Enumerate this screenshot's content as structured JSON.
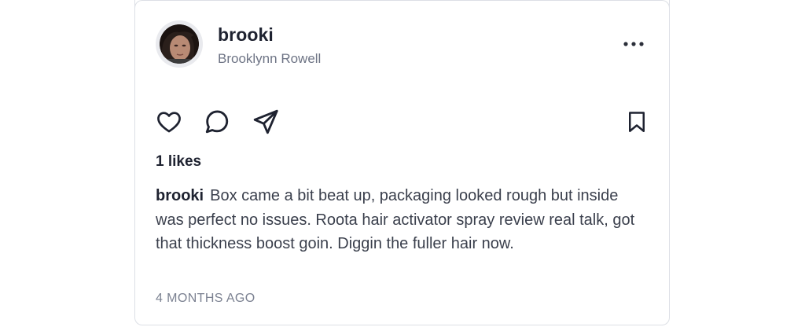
{
  "post": {
    "username": "brooki",
    "full_name": "Brooklynn Rowell",
    "likes_text": "1 likes",
    "caption_user": "brooki",
    "caption_text": "Box came a bit beat up, packaging looked rough but inside was perfect no issues. Roota hair activator spray review real talk, got that thickness boost goin. Diggin the fuller hair now.",
    "timestamp": "4 MONTHS AGO"
  },
  "icons": {
    "more": "more-horizontal-icon",
    "like": "heart-icon",
    "comment": "comment-bubble-icon",
    "share": "send-icon",
    "save": "bookmark-icon"
  },
  "colors": {
    "text_primary": "#1e2230",
    "text_secondary": "#6e7485",
    "border": "#dcdfe5"
  }
}
